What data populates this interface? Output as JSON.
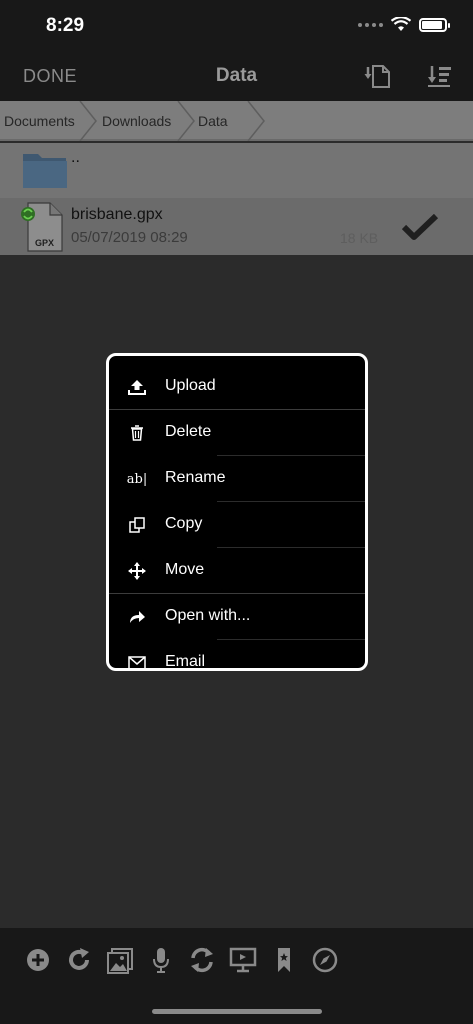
{
  "status_bar": {
    "time": "8:29"
  },
  "nav": {
    "done_label": "DONE",
    "title": "Data"
  },
  "breadcrumb": [
    "Documents",
    "Downloads",
    "Data"
  ],
  "file_list": {
    "parent_label": "..",
    "file": {
      "name": "brisbane.gpx",
      "date": "05/07/2019 08:29",
      "size": "18 KB",
      "type_label": "GPX"
    }
  },
  "menu": {
    "items": [
      {
        "label": "Upload",
        "icon": "upload-icon"
      },
      {
        "label": "Delete",
        "icon": "trash-icon"
      },
      {
        "label": "Rename",
        "icon": "rename-icon",
        "icon_text": "ab|"
      },
      {
        "label": "Copy",
        "icon": "copy-icon"
      },
      {
        "label": "Move",
        "icon": "move-icon"
      },
      {
        "label": "Open with...",
        "icon": "share-arrow-icon"
      },
      {
        "label": "Email",
        "icon": "email-icon"
      }
    ]
  },
  "toolbar": {
    "icons": [
      "add-icon",
      "refresh-icon",
      "photo-icon",
      "microphone-icon",
      "sync-icon",
      "display-icon",
      "bookmark-icon",
      "compass-icon"
    ]
  },
  "colors": {
    "background": "#2b2b2b",
    "bar": "#181818",
    "menu_background": "#000000",
    "menu_border": "#ffffff",
    "gpx_icon_green": "#3a9a2a"
  }
}
